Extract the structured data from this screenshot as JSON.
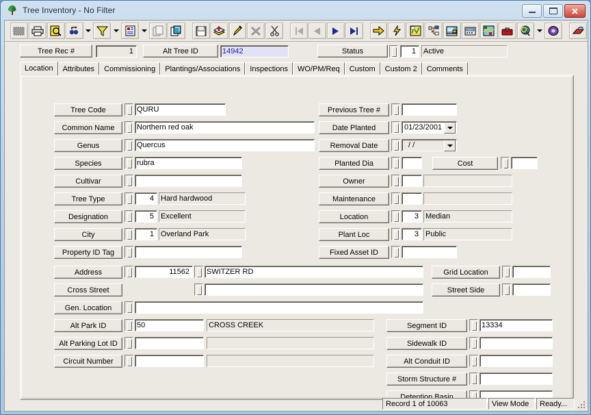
{
  "window": {
    "title": "Tree Inventory - No Filter",
    "icon": "tree-icon",
    "buttons": {
      "minimize": "minimize",
      "maximize": "maximize",
      "close": "close"
    }
  },
  "toolbar": {
    "items": [
      {
        "name": "select-icon",
        "label": ""
      },
      {
        "name": "print-icon",
        "label": ""
      },
      {
        "name": "print-preview-icon",
        "label": ""
      },
      {
        "name": "find-replace-icon",
        "label": ""
      },
      {
        "name": "find-dropdown-arrow",
        "label": ""
      },
      {
        "name": "filter-icon",
        "label": ""
      },
      {
        "name": "filter-dropdown-arrow",
        "label": ""
      },
      {
        "name": "report-icon",
        "label": ""
      },
      {
        "name": "report-dropdown-arrow",
        "label": ""
      },
      {
        "name": "copy-record-icon",
        "label": ""
      },
      {
        "name": "duplicate-icon",
        "label": ""
      },
      {
        "name": "save-icon",
        "label": ""
      },
      {
        "name": "add-record-icon",
        "label": ""
      },
      {
        "name": "edit-icon",
        "label": ""
      },
      {
        "name": "delete-icon",
        "label": ""
      },
      {
        "name": "cut-icon",
        "label": ""
      },
      {
        "name": "first-record-icon",
        "label": ""
      },
      {
        "name": "previous-record-icon",
        "label": ""
      },
      {
        "name": "next-record-icon",
        "label": ""
      },
      {
        "name": "last-record-icon",
        "label": ""
      },
      {
        "name": "goto-icon",
        "label": ""
      },
      {
        "name": "quick-action-icon",
        "label": ""
      },
      {
        "name": "map-icon",
        "label": ""
      },
      {
        "name": "hierarchy-icon",
        "label": ""
      },
      {
        "name": "workstation-icon",
        "label": ""
      },
      {
        "name": "fax-icon",
        "label": ""
      },
      {
        "name": "gis-icon",
        "label": ""
      },
      {
        "name": "toolbox-icon",
        "label": ""
      },
      {
        "name": "web-search-icon",
        "label": ""
      },
      {
        "name": "web-dropdown-arrow",
        "label": ""
      },
      {
        "name": "help-book-icon",
        "label": ""
      },
      {
        "name": "exit-icon",
        "label": ""
      }
    ]
  },
  "record_header": {
    "tree_rec_label": "Tree Rec #",
    "tree_rec_value": "1",
    "alt_tree_id_label": "Alt Tree ID",
    "alt_tree_id_value": "14942",
    "status_label": "Status",
    "status_code": "1",
    "status_text": "Active"
  },
  "tabs": [
    {
      "label": "Location",
      "active": true
    },
    {
      "label": "Attributes",
      "active": false
    },
    {
      "label": "Commissioning",
      "active": false
    },
    {
      "label": "Plantings/Associations",
      "active": false
    },
    {
      "label": "Inspections",
      "active": false
    },
    {
      "label": "WO/PM/Req",
      "active": false
    },
    {
      "label": "Custom",
      "active": false
    },
    {
      "label": "Custom 2",
      "active": false
    },
    {
      "label": "Comments",
      "active": false
    }
  ],
  "left_fields": [
    {
      "label": "Tree Code",
      "value": "QURU"
    },
    {
      "label": "Common Name",
      "value": "Northern red oak"
    },
    {
      "label": "Genus",
      "value": "Quercus"
    },
    {
      "label": "Species",
      "value": "rubra"
    },
    {
      "label": "Cultivar",
      "value": ""
    },
    {
      "label": "Tree Type",
      "code": "4",
      "value": "Hard hardwood"
    },
    {
      "label": "Designation",
      "code": "5",
      "value": "Excellent"
    },
    {
      "label": "City",
      "code": "1",
      "value": "Overland Park"
    },
    {
      "label": "Property ID Tag",
      "value": ""
    }
  ],
  "address_block": {
    "address_label": "Address",
    "address_number": "11562",
    "address_street": "SWITZER RD",
    "cross_street_label": "Cross Street",
    "cross_street_value": "",
    "gen_location_label": "Gen. Location",
    "gen_location_value": "",
    "alt_park_label": "Alt Park ID",
    "alt_park_code": "50",
    "alt_park_value": "CROSS CREEK",
    "alt_parking_lot_label": "Alt Parking Lot ID",
    "alt_parking_lot_code": "",
    "alt_parking_lot_value": "",
    "circuit_label": "Circuit Number",
    "circuit_code": "",
    "circuit_value": ""
  },
  "right_fields": [
    {
      "label": "Previous Tree #",
      "value": ""
    },
    {
      "label": "Date Planted",
      "value": "01/23/2001",
      "type": "date"
    },
    {
      "label": "Removal Date",
      "value": "  /  /",
      "type": "date"
    },
    {
      "label": "Planted Dia",
      "value": "",
      "type": "cost",
      "cost_label": "Cost",
      "cost_value": ""
    },
    {
      "label": "Owner",
      "code": "",
      "value": ""
    },
    {
      "label": "Maintenance",
      "code": "",
      "value": ""
    },
    {
      "label": "Location",
      "code": "3",
      "value": "Median"
    },
    {
      "label": "Plant Loc",
      "code": "3",
      "value": "Public"
    },
    {
      "label": "Fixed Asset ID",
      "value": ""
    }
  ],
  "grid_fields": [
    {
      "label": "Grid Location",
      "value": ""
    },
    {
      "label": "Street Side",
      "value": ""
    }
  ],
  "segment_fields": [
    {
      "label": "Segment ID",
      "value": "13334"
    },
    {
      "label": "Sidewalk ID",
      "value": ""
    },
    {
      "label": "Alt Conduit ID",
      "value": ""
    },
    {
      "label": "Storm Structure #",
      "value": ""
    },
    {
      "label": "Detention Basin",
      "value": ""
    }
  ],
  "status_bar": {
    "record_count": "Record 1 of 10063",
    "mode": "View Mode",
    "state": "Ready..."
  },
  "colors": {
    "face": "#ece9e3",
    "highlight_field_bg": "#e2e2f4",
    "highlight_field_text": "#1a1ab4",
    "title_text": "#1d2f42",
    "close_button": "#cf4436"
  }
}
